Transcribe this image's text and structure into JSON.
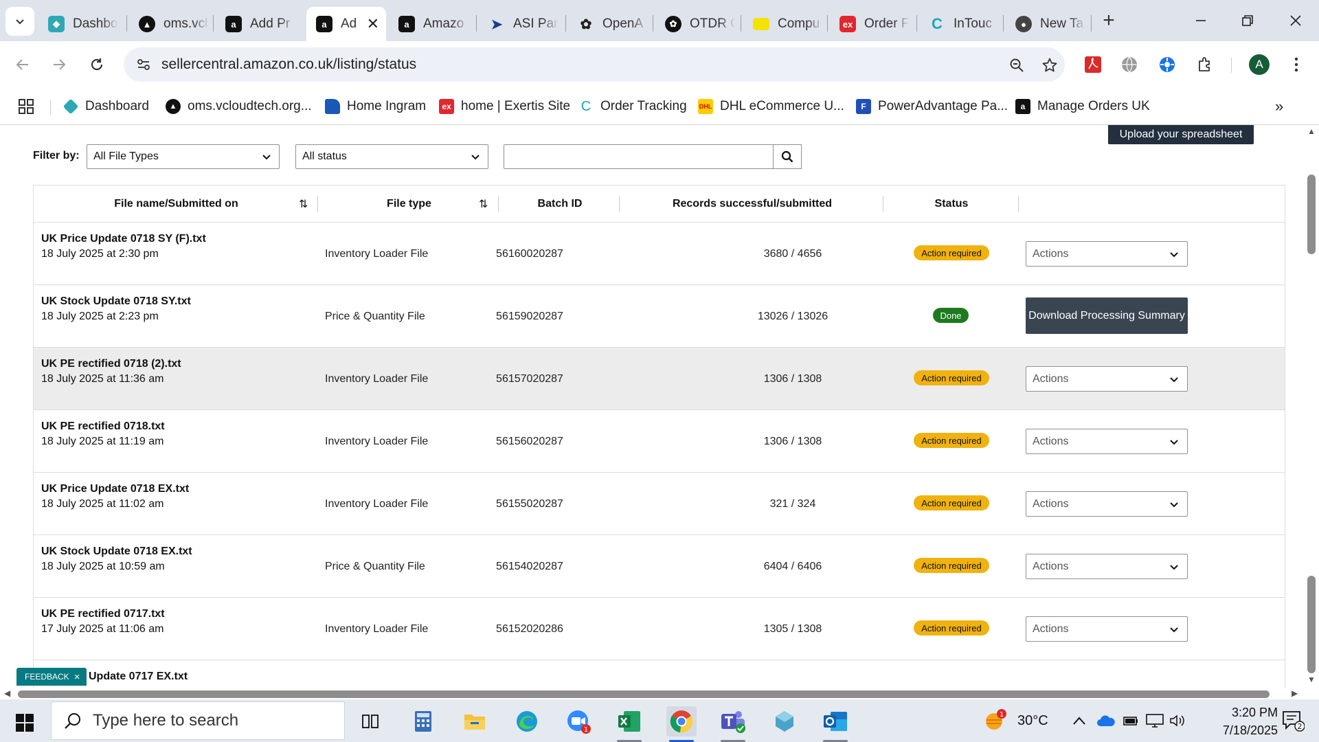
{
  "browser": {
    "tabs": [
      {
        "title": "Dashbo",
        "icon": "dashboard-icon",
        "active": false
      },
      {
        "title": "oms.vcl",
        "icon": "vcloud-icon",
        "active": false
      },
      {
        "title": "Add Pr",
        "icon": "amazon-icon",
        "active": false
      },
      {
        "title": "Ad",
        "icon": "amazon-icon",
        "active": true
      },
      {
        "title": "Amazo",
        "icon": "amazon-icon",
        "active": false
      },
      {
        "title": "ASI Par",
        "icon": "asi-icon",
        "active": false
      },
      {
        "title": "OpenA",
        "icon": "openai-icon",
        "active": false
      },
      {
        "title": "OTDR C",
        "icon": "openai-icon",
        "active": false
      },
      {
        "title": "Compu",
        "icon": "folder-icon",
        "active": false
      },
      {
        "title": "Order F",
        "icon": "exertis-icon",
        "active": false
      },
      {
        "title": "InTouc",
        "icon": "intouch-icon",
        "active": false
      },
      {
        "title": "New Ta",
        "icon": "chrome-icon",
        "active": false
      }
    ],
    "url": "sellercentral.amazon.co.uk/listing/status",
    "profile_initial": "A",
    "bookmarks": [
      {
        "label": "Dashboard",
        "icon": "dashboard-icon"
      },
      {
        "label": "oms.vcloudtech.org...",
        "icon": "vcloud-icon"
      },
      {
        "label": "Home Ingram",
        "icon": "ingram-icon"
      },
      {
        "label": "home | Exertis Site",
        "icon": "exertis-icon"
      },
      {
        "label": "Order Tracking",
        "icon": "intouch-icon"
      },
      {
        "label": "DHL eCommerce U...",
        "icon": "dhl-icon"
      },
      {
        "label": "PowerAdvantage Pa...",
        "icon": "poweradvantage-icon"
      },
      {
        "label": "Manage Orders UK",
        "icon": "amazon-icon"
      }
    ]
  },
  "page": {
    "upload_button": "Upload your spreadsheet",
    "filter_label": "Filter by:",
    "file_type_filter": "All File Types",
    "status_filter": "All status",
    "search_value": "",
    "columns": [
      "File name/Submitted on",
      "File type",
      "Batch ID",
      "Records successful/submitted",
      "Status"
    ],
    "rows": [
      {
        "name": "UK Price Update 0718 SY (F).txt",
        "date": "18 July 2025 at 2:30 pm",
        "type": "Inventory Loader File",
        "batch": "56160020287",
        "records": "3680 / 4656",
        "status": "Action required",
        "status_kind": "warn",
        "action": "Actions"
      },
      {
        "name": "UK Stock Update 0718 SY.txt",
        "date": "18 July 2025 at 2:23 pm",
        "type": "Price & Quantity File",
        "batch": "56159020287",
        "records": "13026 / 13026",
        "status": "Done",
        "status_kind": "done",
        "action": "Download Processing Summary"
      },
      {
        "name": "UK PE rectified 0718 (2).txt",
        "date": "18 July 2025 at 11:36 am",
        "type": "Inventory Loader File",
        "batch": "56157020287",
        "records": "1306 / 1308",
        "status": "Action required",
        "status_kind": "warn",
        "action": "Actions",
        "highlight": true
      },
      {
        "name": "UK PE rectified 0718.txt",
        "date": "18 July 2025 at 11:19 am",
        "type": "Inventory Loader File",
        "batch": "56156020287",
        "records": "1306 / 1308",
        "status": "Action required",
        "status_kind": "warn",
        "action": "Actions"
      },
      {
        "name": "UK Price Update 0718 EX.txt",
        "date": "18 July 2025 at 11:02 am",
        "type": "Inventory Loader File",
        "batch": "56155020287",
        "records": "321 / 324",
        "status": "Action required",
        "status_kind": "warn",
        "action": "Actions"
      },
      {
        "name": "UK Stock Update 0718 EX.txt",
        "date": "18 July 2025 at 10:59 am",
        "type": "Price & Quantity File",
        "batch": "56154020287",
        "records": "6404 / 6406",
        "status": "Action required",
        "status_kind": "warn",
        "action": "Actions"
      },
      {
        "name": "UK PE rectified 0717.txt",
        "date": "17 July 2025 at 11:06 am",
        "type": "Inventory Loader File",
        "batch": "56152020286",
        "records": "1305 / 1308",
        "status": "Action required",
        "status_kind": "warn",
        "action": "Actions"
      },
      {
        "name": "Update 0717 EX.txt",
        "date": "",
        "type": "",
        "batch": "",
        "records": "",
        "status": "",
        "status_kind": "warn",
        "action": ""
      }
    ],
    "feedback_label": "FEEDBACK"
  },
  "taskbar": {
    "search_placeholder": "Type here to search",
    "weather_temp": "30°C",
    "weather_alert_count": "1",
    "teams_badge": "1",
    "time": "3:20 PM",
    "date": "7/18/2025",
    "notification_count": "2"
  },
  "colors": {
    "action_required": "#f0b20f",
    "done": "#1e7a1e",
    "upload_button": "#232f3e",
    "download_button": "#3a4552",
    "feedback": "#087a82"
  }
}
